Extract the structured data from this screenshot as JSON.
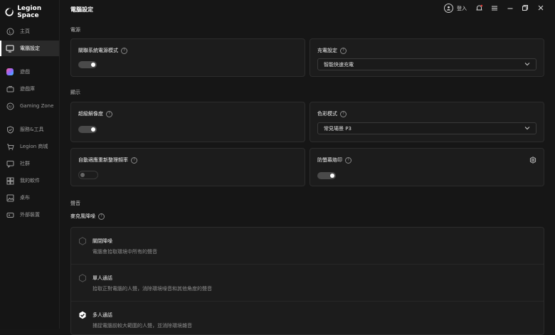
{
  "app": {
    "name": "Legion Space"
  },
  "sidebar": {
    "items": [
      {
        "label": "主頁",
        "icon": "home-icon"
      },
      {
        "label": "電腦設定",
        "icon": "monitor-icon",
        "active": true
      },
      {
        "label": "遊戲",
        "icon": "gamepad-icon"
      },
      {
        "label": "遊戲庫",
        "icon": "library-icon"
      },
      {
        "label": "Gaming Zone",
        "icon": "ai-icon"
      },
      {
        "label": "服務&工具",
        "icon": "shield-icon"
      },
      {
        "label": "Legion 商城",
        "icon": "cart-icon"
      },
      {
        "label": "社群",
        "icon": "community-icon"
      },
      {
        "label": "我的軟件",
        "icon": "software-icon"
      },
      {
        "label": "桌布",
        "icon": "wallpaper-icon"
      },
      {
        "label": "外部裝置",
        "icon": "device-icon"
      }
    ]
  },
  "header": {
    "title": "電腦設定",
    "login": "登入"
  },
  "sections": {
    "power": "電源",
    "display": "顯示",
    "sound": "聲音"
  },
  "settings": {
    "link_power": {
      "label": "關聯系統電源模式",
      "enabled": true
    },
    "charge": {
      "label": "充電設定",
      "value": "智能快速充電"
    },
    "super_res": {
      "label": "超級解像度",
      "enabled": true
    },
    "color_mode": {
      "label": "色彩模式",
      "value": "常見場景 P3"
    },
    "auto_refresh": {
      "label": "自動適應重新整理頻率",
      "enabled": false
    },
    "burn_in": {
      "label": "防螢幕烙印",
      "enabled": true
    }
  },
  "mic": {
    "label": "麥克風降噪",
    "options": [
      {
        "title": "關閉降噪",
        "desc": "電腦會拾取環境中所有的聲音",
        "selected": false
      },
      {
        "title": "單人通話",
        "desc": "拾取正對電腦的人聲，消除環境噪音和其他角度的聲音",
        "selected": false
      },
      {
        "title": "多人通話",
        "desc": "捕捉電腦前較大範圍的人聲，並消除環境雜音",
        "selected": true
      }
    ]
  }
}
